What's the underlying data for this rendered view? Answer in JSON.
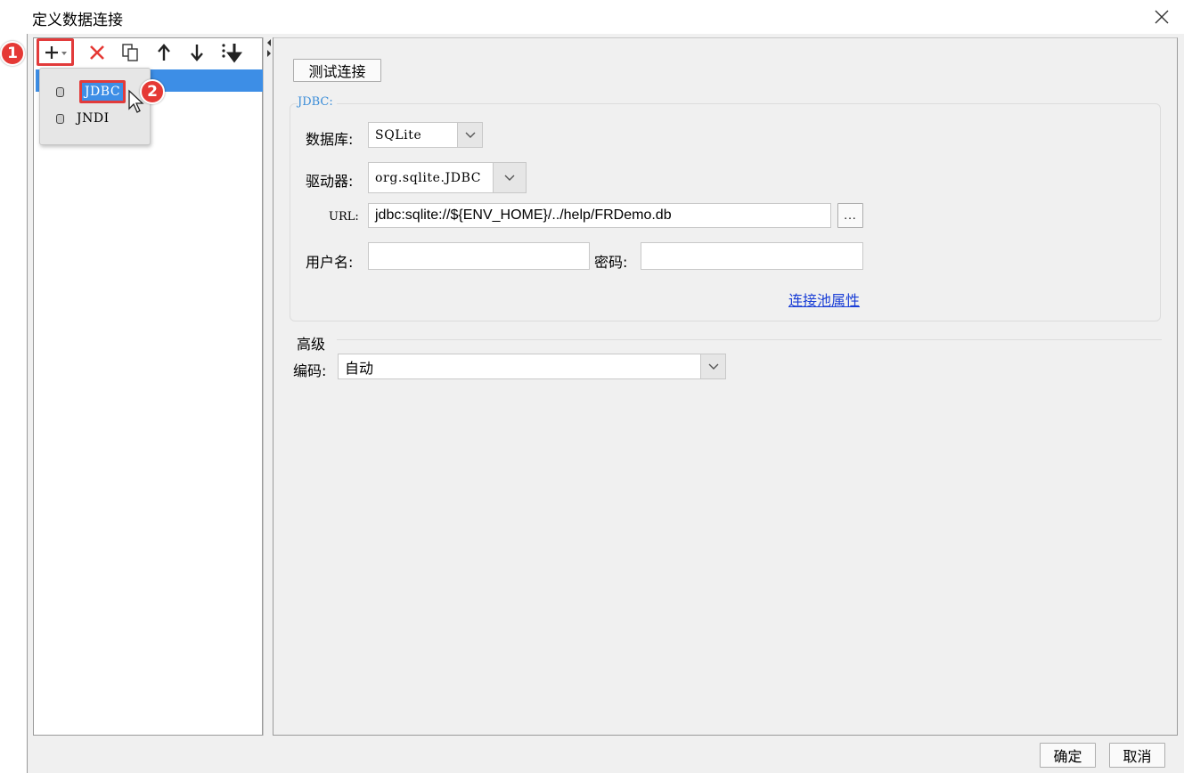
{
  "window": {
    "title": "定义数据连接"
  },
  "toolbar": {
    "add_icon": "plus-icon",
    "delete_icon": "delete-x-icon",
    "copy_icon": "copy-icon",
    "up_icon": "arrow-up-icon",
    "down_icon": "arrow-down-icon",
    "sort_icon": "sort-icon"
  },
  "add_menu": {
    "items": [
      {
        "label": "JDBC",
        "icon": "database-icon",
        "highlighted": true
      },
      {
        "label": "JNDI",
        "icon": "database-icon",
        "highlighted": false
      }
    ]
  },
  "callouts": {
    "step1": "1",
    "step2": "2"
  },
  "right": {
    "test_button": "测试连接",
    "jdbc_group_title": "JDBC:",
    "database_label": "数据库:",
    "database_value": "SQLite",
    "driver_label": "驱动器:",
    "driver_value": "org.sqlite.JDBC",
    "url_label": "URL:",
    "url_value": "jdbc:sqlite://${ENV_HOME}/../help/FRDemo.db",
    "browse_label": "...",
    "username_label": "用户名:",
    "username_value": "",
    "password_label": "密码:",
    "password_value": "",
    "pool_link": "连接池属性",
    "advanced_title": "高级",
    "encoding_label": "编码:",
    "encoding_value": "自动"
  },
  "footer": {
    "ok": "确定",
    "cancel": "取消"
  },
  "colors": {
    "selection": "#3d8ee6",
    "callout": "#e53935",
    "group_title": "#3b8dd8",
    "link": "#1a3ed6"
  }
}
